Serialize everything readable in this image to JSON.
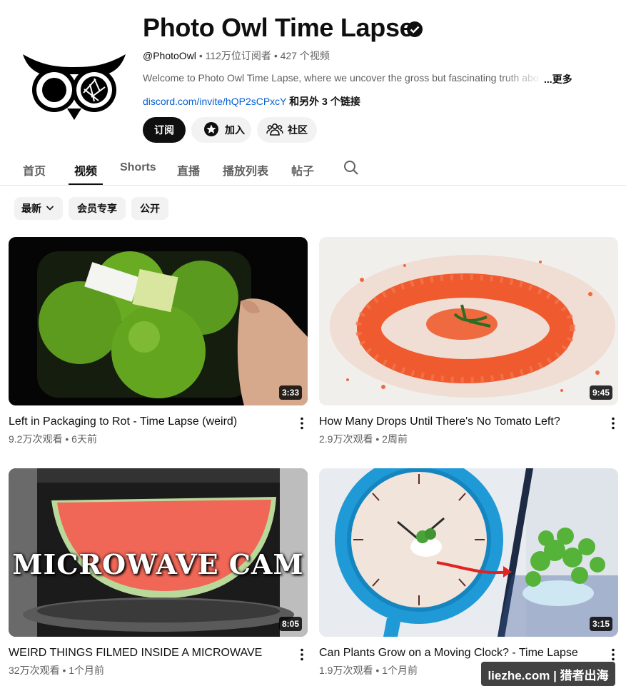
{
  "channel": {
    "name": "Photo Owl Time Lapse",
    "handle": "@PhotoOwl",
    "subscribers": "112万位订阅者",
    "videos": "427 个视频",
    "separator": "•",
    "description": "Welcome to Photo Owl Time Lapse, where we uncover the gross but fascinating truth abo",
    "more_label": "...更多",
    "link": "discord.com/invite/hQP2sCPxcY",
    "link_more": "和另外 3 个链接"
  },
  "buttons": {
    "subscribe": "订阅",
    "join": "加入",
    "community": "社区"
  },
  "tabs": [
    {
      "label": "首页"
    },
    {
      "label": "视频",
      "active": true
    },
    {
      "label": "Shorts"
    },
    {
      "label": "直播"
    },
    {
      "label": "播放列表"
    },
    {
      "label": "帖子"
    }
  ],
  "chips": {
    "sort": "最新",
    "members": "会员专享",
    "public": "公开"
  },
  "videos": [
    {
      "title": "Left in Packaging to Rot - Time Lapse (weird)",
      "views": "9.2万次观看",
      "age": "6天前",
      "duration": "3:33"
    },
    {
      "title": "How Many Drops Until There's No Tomato Left?",
      "views": "2.9万次观看",
      "age": "2周前",
      "duration": "9:45"
    },
    {
      "title": "WEIRD THINGS FILMED INSIDE A MICROWAVE",
      "views": "32万次观看",
      "age": "1个月前",
      "duration": "8:05",
      "overlay": "MICROWAVE CAM"
    },
    {
      "title": "Can Plants Grow on a Moving Clock? - Time Lapse",
      "views": "1.9万次观看",
      "age": "1个月前",
      "duration": "3:15"
    }
  ],
  "watermark": "liezhe.com | 猎者出海",
  "colors": {
    "link": "#065fd4",
    "subscribe_bg": "#0f0f0f",
    "chip_bg": "#f2f2f2",
    "secondary_text": "#606060"
  },
  "icons": [
    "owl-logo",
    "verified-icon",
    "star-icon",
    "community-icon",
    "search-icon",
    "chevron-down-icon",
    "more-vert-icon"
  ]
}
